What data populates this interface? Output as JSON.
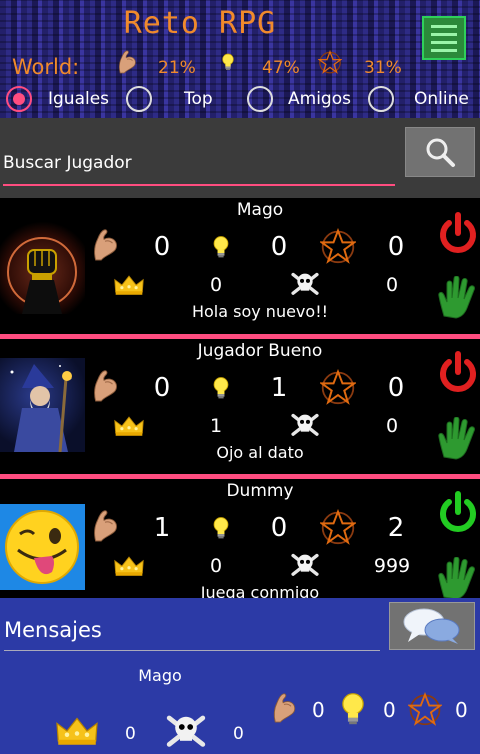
{
  "app": {
    "title": "Reto RPG"
  },
  "world": {
    "label": "World:",
    "stats": [
      {
        "icon": "arm-icon",
        "value": "21%"
      },
      {
        "icon": "lightbulb-icon",
        "value": "47%"
      },
      {
        "icon": "pentagram-icon",
        "value": "31%"
      }
    ]
  },
  "filters": {
    "options": [
      {
        "label": "Iguales",
        "checked": true
      },
      {
        "label": "Top",
        "checked": false
      },
      {
        "label": "Amigos",
        "checked": false
      },
      {
        "label": "Online",
        "checked": false
      }
    ]
  },
  "search": {
    "value": "Buscar Jugador",
    "placeholder": "Buscar Jugador"
  },
  "players": [
    {
      "name": "Mago",
      "strength": "0",
      "wisdom": "0",
      "magic": "0",
      "crowns": "0",
      "kills": "0",
      "message": "Hola soy nuevo!!",
      "online": false,
      "avatar": "fist-icon"
    },
    {
      "name": "Jugador Bueno",
      "strength": "0",
      "wisdom": "1",
      "magic": "0",
      "crowns": "1",
      "kills": "0",
      "message": "Ojo al dato",
      "online": false,
      "avatar": "wizard-icon"
    },
    {
      "name": "Dummy",
      "strength": "1",
      "wisdom": "0",
      "magic": "2",
      "crowns": "0",
      "kills": "999",
      "message": "Juega conmigo",
      "online": true,
      "avatar": "winking-emoji-icon"
    }
  ],
  "messages": {
    "title": "Mensajes",
    "items": [
      {
        "name": "Mago",
        "crowns": "0",
        "kills": "0",
        "strength": "0",
        "wisdom": "0",
        "magic": "0"
      }
    ]
  },
  "colors": {
    "accent": "#ff4d80",
    "title": "#f08a2c",
    "online": "#22cc22",
    "offline": "#e02020",
    "panel": "#2c3aa6"
  }
}
